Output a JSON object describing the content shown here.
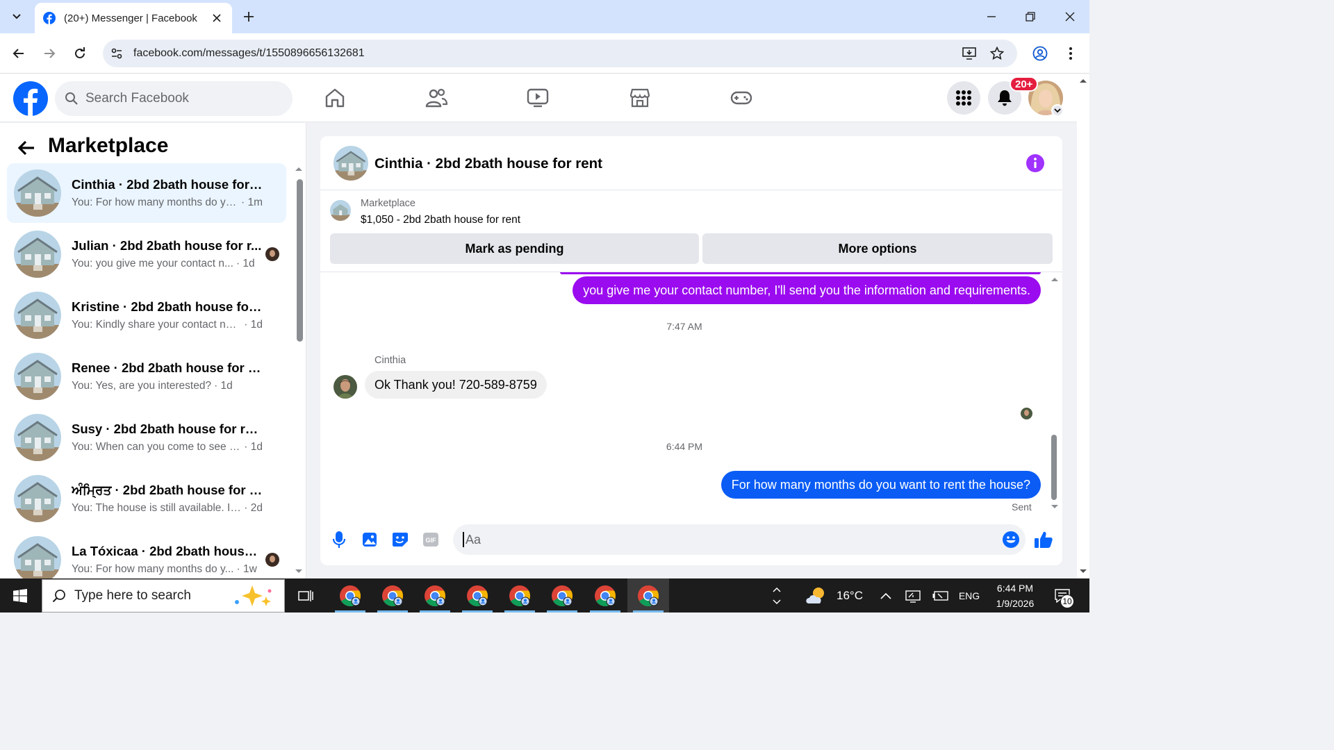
{
  "browser": {
    "tab_title": "(20+) Messenger | Facebook",
    "url": "facebook.com/messages/t/1550896656132681"
  },
  "header": {
    "search_placeholder": "Search Facebook",
    "notification_badge": "20+",
    "nav_icons": [
      "home-icon",
      "friends-icon",
      "video-icon",
      "marketplace-icon",
      "gaming-icon"
    ],
    "brand_color": "#0866ff"
  },
  "sidebar": {
    "title": "Marketplace",
    "conversations": [
      {
        "name": "Cinthia · 2bd 2bath house for rent",
        "snippet": "You: For how many months do yo...",
        "time": "· 1m",
        "active": true
      },
      {
        "name": "Julian · 2bd 2bath house for r...",
        "snippet": "You: you give me your contact n...",
        "time": "· 1d",
        "active": false
      },
      {
        "name": "Kristine · 2bd 2bath house for re...",
        "snippet": "You: Kindly share your contact num...",
        "time": "· 1d",
        "active": false
      },
      {
        "name": "Renee · 2bd 2bath house for rent",
        "snippet": "You: Yes, are you interested?",
        "time": "· 1d",
        "active": false
      },
      {
        "name": "Susy · 2bd 2bath house for rent",
        "snippet": "You: When can you come to see th...",
        "time": "· 1d",
        "active": false
      },
      {
        "name": "ਅੰਮ੍ਰਿਤ · 2bd 2bath house for rent",
        "snippet": "You: The house is still available. If y...",
        "time": "· 2d",
        "active": false
      },
      {
        "name": "La Tóxicaa · 2bd 2bath house ...",
        "snippet": "You: For how many months do y...",
        "time": "· 1w",
        "active": false
      }
    ]
  },
  "chat": {
    "title": "Cinthia · 2bd 2bath house for rent",
    "listing_category": "Marketplace",
    "listing_price": "$1,050 - 2bd 2bath house for rent",
    "mark_pending_label": "Mark as pending",
    "more_options_label": "More options",
    "messages": {
      "out_1": "you give me your contact number, I'll send you the information and requirements.",
      "time_1": "7:47 AM",
      "sender": "Cinthia",
      "in_1": "Ok Thank you! 720-589-8759",
      "time_2": "6:44 PM",
      "out_2": "For how many months do you want to rent the house?",
      "status": "Sent"
    },
    "composer_placeholder": "Aa",
    "bubble_colors": {
      "purple": "#9b0bef",
      "blue": "#0a5cf5"
    }
  },
  "taskbar": {
    "search_placeholder": "Type here to search",
    "temperature": "16°C",
    "language": "ENG",
    "time": "6:44 PM",
    "date": "1/9/2026",
    "notification_count": "10"
  }
}
